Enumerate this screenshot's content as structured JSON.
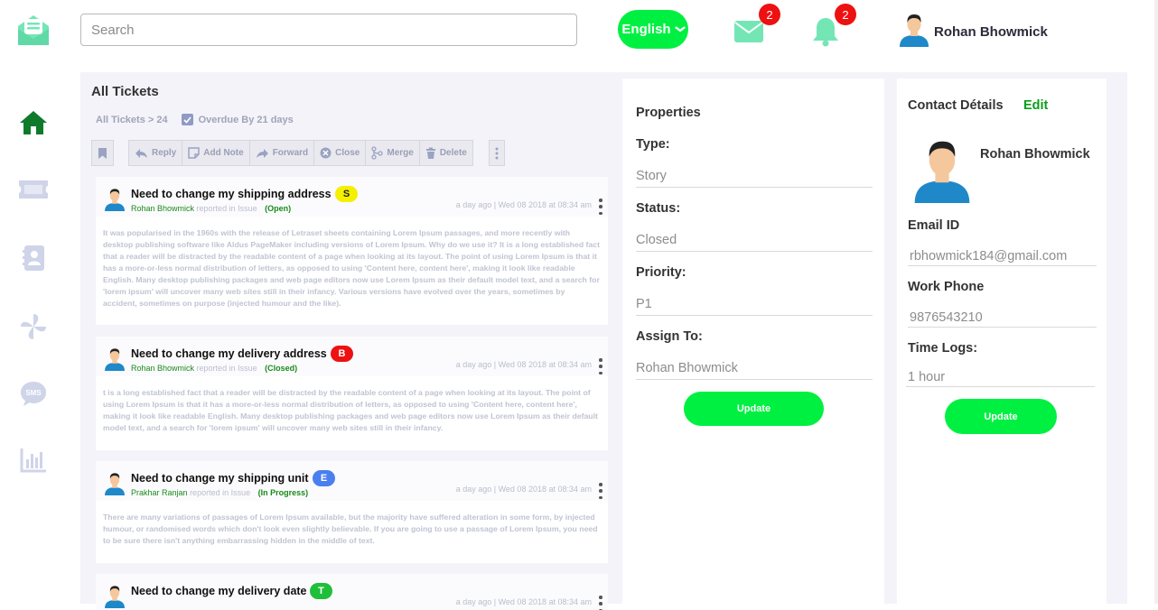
{
  "search": {
    "placeholder": "Search"
  },
  "language": {
    "label": "English"
  },
  "notifications": {
    "mail_count": "2",
    "bell_count": "2"
  },
  "user": {
    "name": "Rohan Bhowmick"
  },
  "colors": {
    "accent": "#00f042",
    "link_green": "#0a9d1a",
    "badge_red": "#ee1111"
  },
  "sidebar": {
    "items": [
      {
        "icon": "home-icon",
        "active": true
      },
      {
        "icon": "ticket-icon"
      },
      {
        "icon": "contacts-book-icon"
      },
      {
        "icon": "pinwheel-icon"
      },
      {
        "icon": "sms-icon"
      },
      {
        "icon": "bar-chart-icon"
      }
    ]
  },
  "tickets_panel": {
    "title": "All Tickets",
    "breadcrumb": "All Tickets > 24",
    "overdue_label": "Overdue By 21 days",
    "toolbar": {
      "reply": "Reply",
      "add_note": "Add Note",
      "forward": "Forward",
      "close": "Close",
      "merge": "Merge",
      "delete": "Delete"
    },
    "tickets": [
      {
        "title": "Need to change my shipping address",
        "tag": "S",
        "tag_color": "#f5f000",
        "tag_text_color": "#222222",
        "reporter": "Rohan Bhowmick",
        "reported_in": "reported in Issue",
        "status": "(Open)",
        "time": "a day ago | Wed 08 2018 at 08:34 am",
        "body": "It was popularised in the 1960s with the release of Letraset sheets containing Lorem Ipsum passages, and more recently with desktop publishing software like Aldus PageMaker including versions of Lorem Ipsum. Why do we use it? It is a long established fact that a reader will be distracted by the readable content of a page when looking at its layout. The point of using Lorem Ipsum is that it has a more-or-less normal distribution of letters, as opposed to using 'Content here, content here', making it look like readable English. Many desktop publishing packages and web page editors now use Lorem Ipsum as their default model text, and a search for 'lorem ipsum' will uncover many web sites still in their infancy. Various versions have evolved over the years, sometimes by accident, sometimes on purpose (injected humour and the like)."
      },
      {
        "title": "Need to change my delivery address",
        "tag": "B",
        "tag_color": "#ee1111",
        "tag_text_color": "#ffffff",
        "reporter": "Rohan Bhowmick",
        "reported_in": "reported in Issue",
        "status": "(Closed)",
        "time": "a day ago | Wed 08 2018 at 08:34 am",
        "body": "t is a long established fact that a reader will be distracted by the readable content of a page when looking at its layout. The point of using Lorem Ipsum is that it has a more-or-less normal distribution of letters, as opposed to using 'Content here, content here', making it look like readable English. Many desktop publishing packages and web page editors now use Lorem Ipsum as their default model text, and a search for 'lorem ipsum' will uncover many web sites still in their infancy."
      },
      {
        "title": "Need to change my shipping unit",
        "tag": "E",
        "tag_color": "#4a7ff0",
        "tag_text_color": "#ffffff",
        "reporter": "Prakhar Ranjan",
        "reported_in": "reported in Issue",
        "status": "(In Progress)",
        "time": "a day ago | Wed 08 2018 at 08:34 am",
        "body": "There are many variations of passages of Lorem Ipsum available, but the majority have suffered alteration in some form, by injected humour, or randomised words which don't look even slightly believable. If you are going to use a passage of Lorem Ipsum, you need to be sure there isn't anything embarrassing hidden in the middle of text."
      },
      {
        "title": "Need to change my delivery date",
        "tag": "T",
        "tag_color": "#1fbf3a",
        "tag_text_color": "#ffffff",
        "reporter": "",
        "reported_in": "",
        "status": "",
        "time": "a day ago | Wed 08 2018 at 08:34 am",
        "body": ""
      }
    ]
  },
  "properties": {
    "title": "Properties",
    "type_label": "Type:",
    "type_value": "Story",
    "status_label": "Status:",
    "status_value": "Closed",
    "priority_label": "Priority:",
    "priority_value": "P1",
    "assign_label": "Assign To:",
    "assign_value": "Rohan Bhowmick",
    "update_label": "Update"
  },
  "contact": {
    "title": "Contact Détails",
    "edit_label": "Edit",
    "name": "Rohan Bhowmick",
    "email_label": "Email ID",
    "email_value": "rbhowmick184@gmail.com",
    "phone_label": "Work Phone",
    "phone_value": "9876543210",
    "timelogs_label": "Time Logs:",
    "timelogs_value": "1 hour",
    "update_label": "Update"
  }
}
